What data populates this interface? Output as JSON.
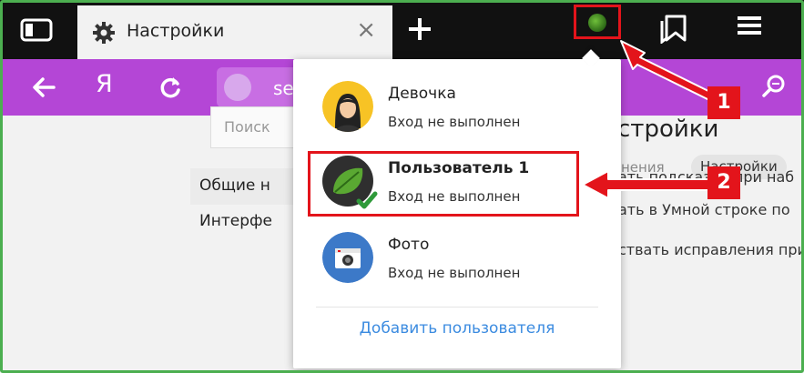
{
  "browser": {
    "tab_title": "Настройки",
    "tab_close": "×",
    "yandex_label": "Я",
    "omnibox_text": "se"
  },
  "page": {
    "breadcrumb_prev": "нения",
    "breadcrumb_current": "Настройки",
    "search_placeholder": "Поиск",
    "nav_items": [
      "Общие н",
      "Интерфе"
    ],
    "heading": "стройки",
    "setting_lines": [
      "ать подсказки при наб",
      "ать в Умной строке по",
      "ствать исправления при о"
    ]
  },
  "profiles": [
    {
      "name": "Девочка",
      "status": "Вход не выполнен"
    },
    {
      "name": "Пользователь 1",
      "status": "Вход не выполнен"
    },
    {
      "name": "Фото",
      "status": "Вход не выполнен"
    }
  ],
  "add_user_label": "Добавить пользователя",
  "callouts": {
    "first": "1",
    "second": "2"
  },
  "colors": {
    "tabbar": "#111111",
    "navbar": "#b446d6",
    "annotation": "#e3141b",
    "link": "#3b8be0",
    "frame": "#4caf50"
  },
  "icons": [
    "sidebar-icon",
    "gear-icon",
    "plus-icon",
    "leaf-avatar-icon",
    "bookmarks-icon",
    "hamburger-icon",
    "back-arrow-icon",
    "reload-icon",
    "search-icon",
    "checkmark-icon",
    "camera-icon"
  ]
}
